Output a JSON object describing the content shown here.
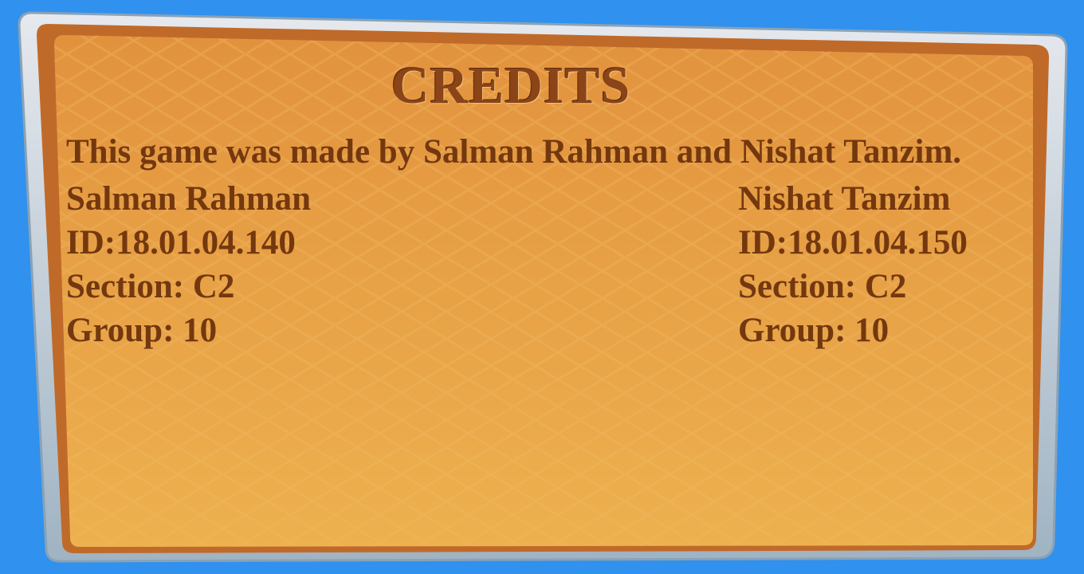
{
  "credits": {
    "title": "CREDITS",
    "intro": "This game was made by Salman Rahman and Nishat Tanzim.",
    "members": [
      {
        "name": "Salman Rahman",
        "id": "ID:18.01.04.140",
        "section": "Section: C2",
        "group": "Group: 10"
      },
      {
        "name": "Nishat Tanzim",
        "id": "ID:18.01.04.150",
        "section": "Section: C2",
        "group": "Group: 10"
      }
    ]
  },
  "colors": {
    "background": "#3091ee",
    "frame": "#c9d4de",
    "panel": "#e9a247",
    "text": "#74380f"
  }
}
